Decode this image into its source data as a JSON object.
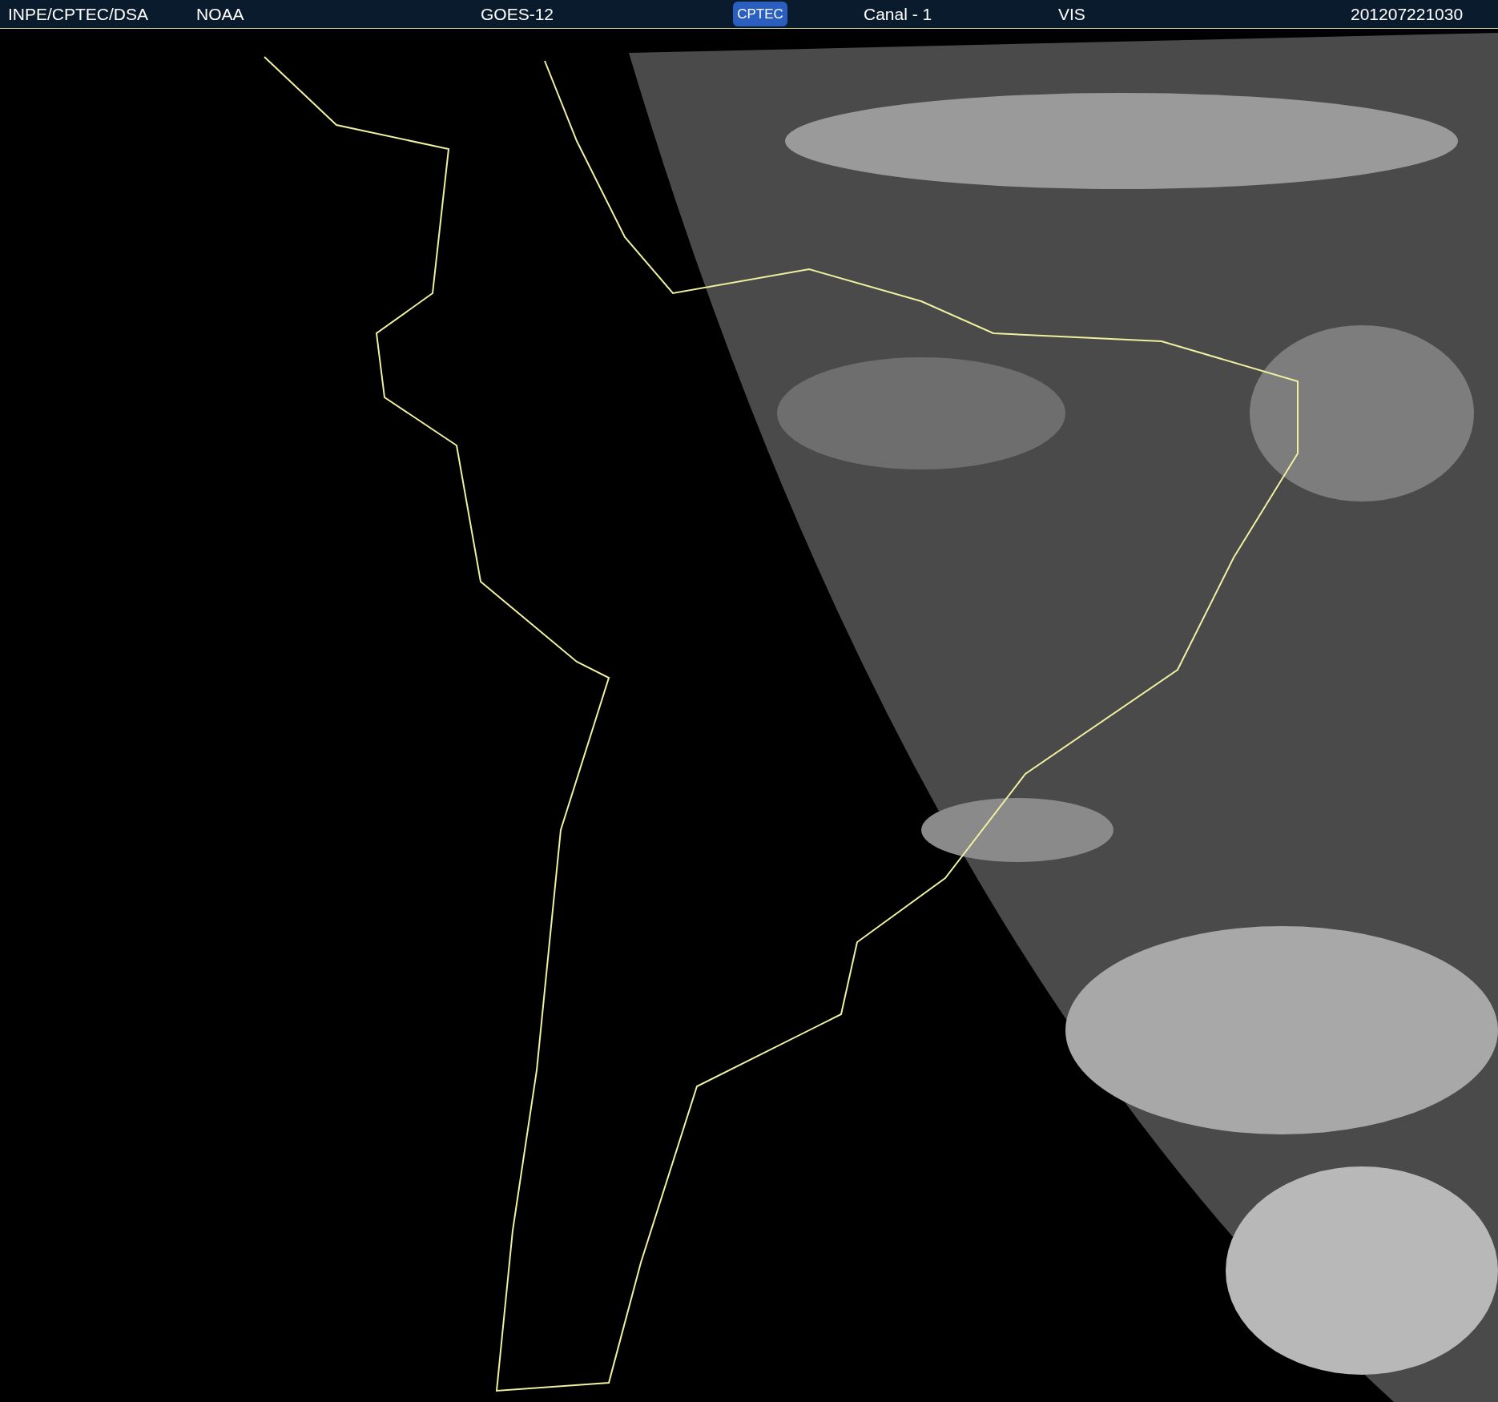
{
  "header": {
    "source": "INPE/CPTEC/DSA",
    "agency": "NOAA",
    "satellite": "GOES-12",
    "logo": "CPTEC",
    "channel": "Canal - 1",
    "band": "VIS",
    "timestamp": "201207221030"
  }
}
